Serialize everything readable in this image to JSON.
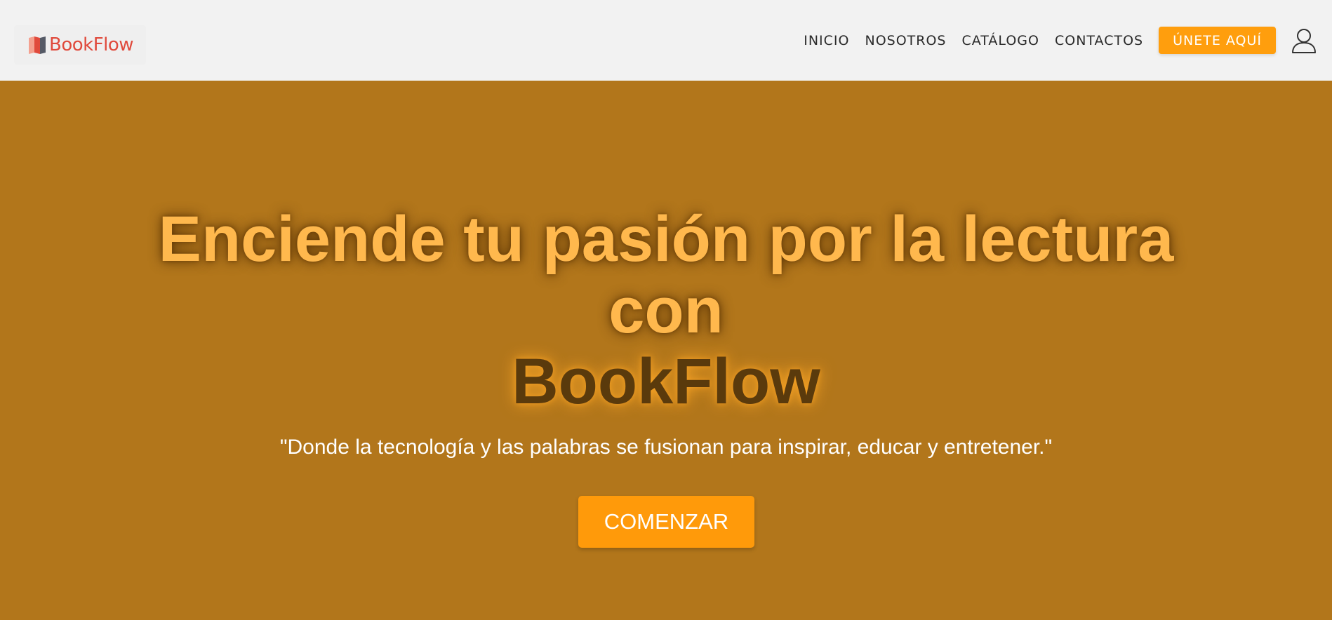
{
  "brand": {
    "name": "BookFlow",
    "logo_icon": "book-icon",
    "color": "#e04a3c"
  },
  "nav": {
    "items": [
      {
        "label": "INICIO"
      },
      {
        "label": "NOSOTROS"
      },
      {
        "label": "CATÁLOGO"
      },
      {
        "label": "CONTACTOS"
      }
    ],
    "join_label": "ÚNETE AQUÍ",
    "user_icon": "user-icon"
  },
  "hero": {
    "title_line1": "Enciende tu pasión por la lectura",
    "title_line2": "con",
    "brand_line": "BookFlow",
    "quote": "\"Donde la tecnología y las palabras se fusionan para inspirar, educar y entretener.\"",
    "cta_label": "COMENZAR"
  },
  "colors": {
    "header_bg": "#f2f2f2",
    "hero_bg": "#b2761b",
    "accent": "#ff9e0d",
    "title": "#ffb84d",
    "brand_dark": "#5a3a0c"
  }
}
